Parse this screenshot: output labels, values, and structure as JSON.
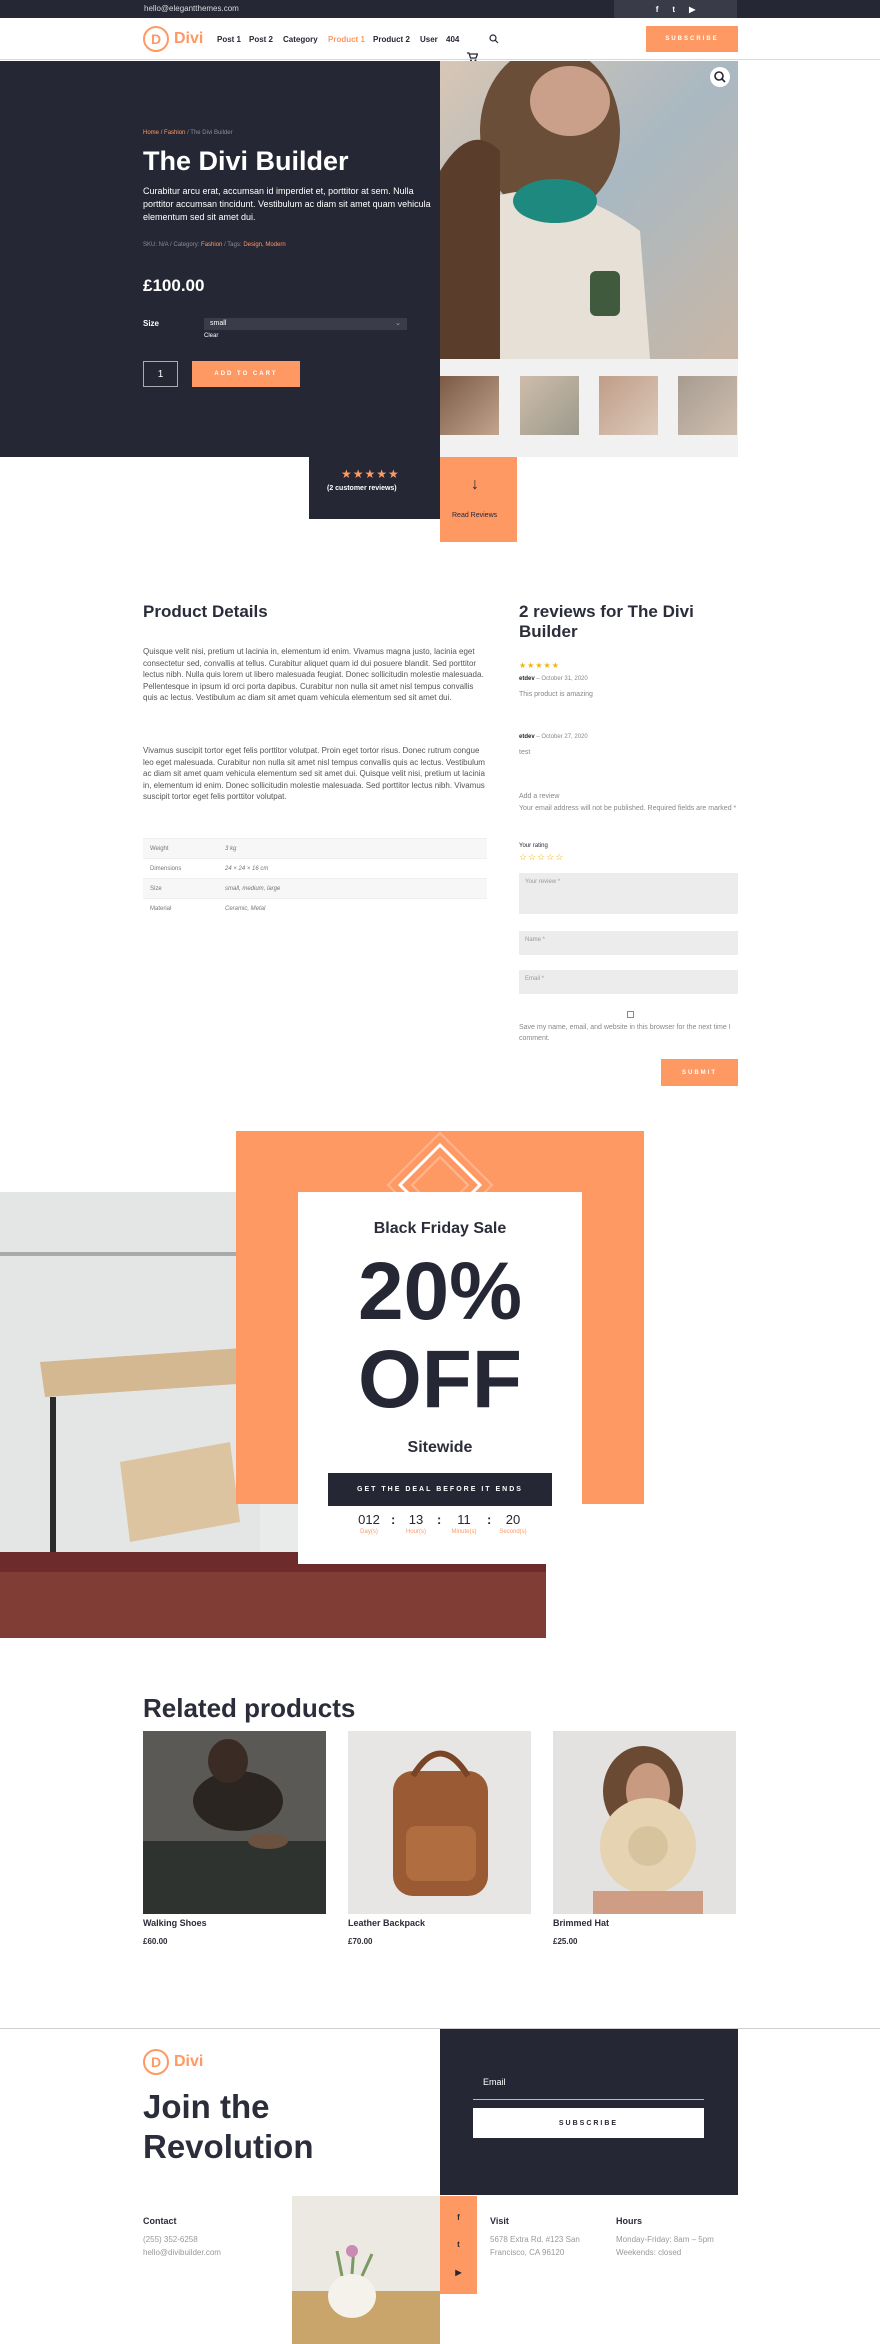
{
  "topbar": {
    "email": "hello@elegantthemes.com",
    "social": [
      "f",
      "t",
      "▶"
    ]
  },
  "nav": {
    "logo_letter": "D",
    "logo_text": "Divi",
    "items": [
      "Post 1",
      "Post 2",
      "Category",
      "Product 1",
      "Product 2",
      "User",
      "404"
    ],
    "active_item": "Product 1",
    "subscribe": "SUBSCRIBE"
  },
  "product": {
    "breadcrumb_home": "Home",
    "breadcrumb_cat": "Fashion",
    "breadcrumb_current": "/ The Divi Builder",
    "title": "The Divi Builder",
    "description": "Curabitur arcu erat, accumsan id imperdiet et, porttitor at sem. Nulla porttitor accumsan tincidunt. Vestibulum ac diam sit amet quam vehicula elementum sed sit amet dui.",
    "meta_sku": "SKU: N/A / Category:",
    "meta_category": "Fashion",
    "meta_tags_label": "/ Tags:",
    "meta_tags": "Design, Modern",
    "price": "£100.00",
    "size_label": "Size",
    "size_value": "small",
    "clear": "Clear",
    "quantity": "1",
    "add_to_cart": "ADD TO CART",
    "rating_stars": "★★★★★",
    "rating_value": 5,
    "review_count": "(2 customer reviews)",
    "read_reviews": "Read Reviews"
  },
  "details": {
    "title": "Product Details",
    "para1": "Quisque velit nisi, pretium ut lacinia in, elementum id enim. Vivamus magna justo, lacinia eget consectetur sed, convallis at tellus. Curabitur aliquet quam id dui posuere blandit. Sed porttitor lectus nibh. Nulla quis lorem ut libero malesuada feugiat. Donec sollicitudin molestie malesuada. Pellentesque in ipsum id orci porta dapibus. Curabitur non nulla sit amet nisl tempus convallis quis ac lectus. Vestibulum ac diam sit amet quam vehicula elementum sed sit amet dui.",
    "para2": "Vivamus suscipit tortor eget felis porttitor volutpat. Proin eget tortor risus. Donec rutrum congue leo eget malesuada. Curabitur non nulla sit amet nisl tempus convallis quis ac lectus. Vestibulum ac diam sit amet quam vehicula elementum sed sit amet dui. Quisque velit nisi, pretium ut lacinia in, elementum id enim. Donec sollicitudin molestie malesuada. Sed porttitor lectus nibh. Vivamus suscipit tortor eget felis porttitor volutpat.",
    "specs": [
      {
        "key": "Weight",
        "value": "3 kg"
      },
      {
        "key": "Dimensions",
        "value": "24 × 24 × 16 cm"
      },
      {
        "key": "Size",
        "value": "small, medium, large"
      },
      {
        "key": "Material",
        "value": "Ceramic, Metal"
      }
    ]
  },
  "reviews": {
    "title": "2 reviews for The Divi Builder",
    "items": [
      {
        "stars": "★★★★★",
        "author": "etdev",
        "date": "– October 31, 2020",
        "text": "This product is amazing"
      },
      {
        "stars": "",
        "author": "etdev",
        "date": "– October 27, 2020",
        "text": "test"
      }
    ],
    "add_review": "Add a review",
    "notice": "Your email address will not be published. Required fields are marked *",
    "your_rating": "Your rating",
    "rating_empty": "☆☆☆☆☆",
    "review_placeholder": "Your review *",
    "name_placeholder": "Name *",
    "email_placeholder": "Email *",
    "save_info": "Save my name, email, and website in this browser for the next time I comment.",
    "submit": "SUBMIT"
  },
  "sale": {
    "title": "Black Friday Sale",
    "percent": "20%",
    "off": "OFF",
    "sitewide": "Sitewide",
    "button": "GET THE DEAL BEFORE IT ENDS",
    "countdown": [
      {
        "value": "012",
        "label": "Day(s)"
      },
      {
        "value": "13",
        "label": "Hour(s)"
      },
      {
        "value": "11",
        "label": "Minute(s)"
      },
      {
        "value": "20",
        "label": "Second(s)"
      }
    ]
  },
  "related": {
    "title": "Related products",
    "items": [
      {
        "name": "Walking Shoes",
        "price": "£60.00"
      },
      {
        "name": "Leather Backpack",
        "price": "£70.00"
      },
      {
        "name": "Brimmed Hat",
        "price": "£25.00"
      }
    ]
  },
  "footer": {
    "logo_letter": "D",
    "logo_text": "Divi",
    "join": "Join the Revolution",
    "email_label": "Email",
    "subscribe": "SUBSCRIBE",
    "contact_title": "Contact",
    "contact_phone": "(255) 352-6258",
    "contact_email": "hello@divibuilder.com",
    "visit_title": "Visit",
    "visit_line1": "5678 Extra Rd. #123 San",
    "visit_line2": "Francisco, CA 96120",
    "hours_title": "Hours",
    "hours_line1": "Monday-Friday: 8am – 5pm",
    "hours_line2": "Weekends: closed",
    "social": [
      "f",
      "t",
      "▶"
    ]
  }
}
